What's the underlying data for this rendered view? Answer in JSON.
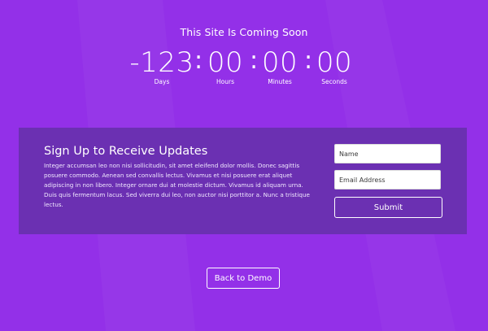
{
  "page": {
    "title": "This Site Is Coming Soon",
    "background_color": "#9330e8",
    "panel_color": "#6b30b2"
  },
  "countdown": {
    "days": {
      "value": "-123",
      "label": "Days"
    },
    "hours": {
      "value": "00",
      "label": "Hours"
    },
    "minutes": {
      "value": "00",
      "label": "Minutes"
    },
    "seconds": {
      "value": "00",
      "label": "Seconds"
    },
    "separator": ":"
  },
  "signup": {
    "heading": "Sign Up to Receive Updates",
    "description": "Integer accumsan leo non nisi sollicitudin, sit amet eleifend dolor mollis. Donec sagittis posuere commodo. Aenean sed convallis lectus. Vivamus et nisi posuere erat aliquet adipiscing in non libero. Integer ornare dui at molestie dictum. Vivamus id aliquam urna. Duis quis fermentum lacus. Sed viverra dui leo, non auctor nisi porttitor a. Nunc a tristique lectus.",
    "name_placeholder": "Name",
    "email_placeholder": "Email Address",
    "submit_label": "Submit"
  },
  "footer": {
    "back_label": "Back to Demo"
  }
}
